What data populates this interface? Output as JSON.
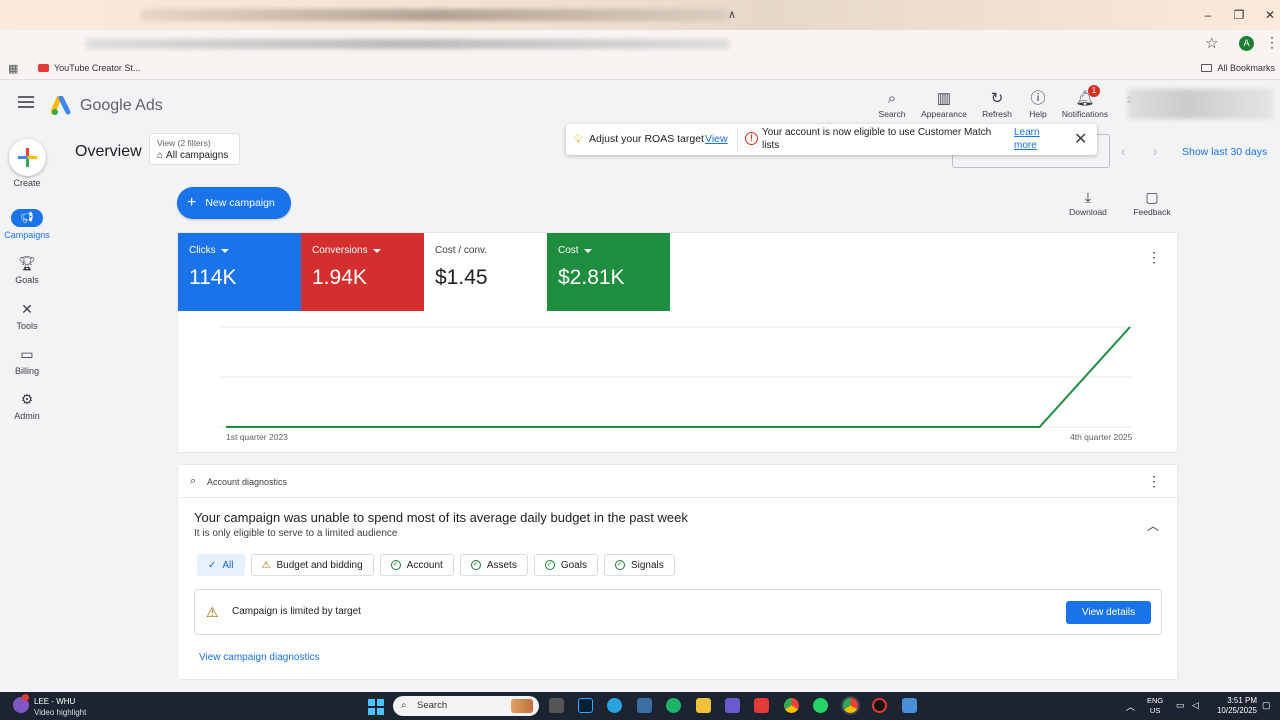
{
  "browser": {
    "bookmarks": [
      {
        "label": "YouTube Creator St..."
      }
    ],
    "all_bookmarks": "All Bookmarks",
    "profile_initial": "A",
    "win_controls": {
      "minimize": "–",
      "restore": "❐",
      "close": "✕"
    }
  },
  "header": {
    "brand": "Google Ads",
    "buttons": {
      "search": "Search",
      "appearance": "Appearance",
      "refresh": "Refresh",
      "help": "Help",
      "notifications": "Notifications"
    },
    "notification_count": "1",
    "account_prefix": "22"
  },
  "rail": {
    "create": "Create",
    "campaigns": "Campaigns",
    "goals": "Goals",
    "tools": "Tools",
    "billing": "Billing",
    "admin": "Admin"
  },
  "overview": {
    "title": "Overview",
    "filter_small": "View (2 filters)",
    "filter_big": "All campaigns",
    "show_last": "Show last 30 days"
  },
  "toast": {
    "message1": "Adjust your ROAS target",
    "view": "View",
    "message2": "Your account is now eligible to use Customer Match lists",
    "learn_more": "Learn more"
  },
  "actions": {
    "new_campaign": "New campaign",
    "download": "Download",
    "feedback": "Feedback"
  },
  "metrics": [
    {
      "label": "Clicks",
      "value": "114K",
      "color": "#1a73e8",
      "dropdown": true
    },
    {
      "label": "Conversions",
      "value": "1.94K",
      "color": "#d32f2f",
      "dropdown": true
    },
    {
      "label": "Cost / conv.",
      "value": "$1.45",
      "color": "#ffffff",
      "dropdown": false
    },
    {
      "label": "Cost",
      "value": "$2.81K",
      "color": "#1e8e3e",
      "dropdown": true
    }
  ],
  "chart_data": {
    "type": "line",
    "x": [
      "1st quarter 2023",
      "4th quarter 2025"
    ],
    "tick_labels": [
      "1st quarter 2023",
      "4th quarter 2025"
    ],
    "series": [
      {
        "color": "#1e8e3e",
        "values": [
          0,
          0,
          0,
          0,
          0,
          0,
          0,
          0,
          0,
          0,
          1
        ]
      }
    ],
    "grid": true
  },
  "diagnostics": {
    "header": "Account diagnostics",
    "title": "Your campaign was unable to spend most of its average daily budget in the past week",
    "subtitle": "It is only eligible to serve to a limited audience",
    "chips": [
      {
        "label": "All",
        "kind": "selected"
      },
      {
        "label": "Budget and bidding",
        "kind": "warning"
      },
      {
        "label": "Account",
        "kind": "ok"
      },
      {
        "label": "Assets",
        "kind": "ok"
      },
      {
        "label": "Goals",
        "kind": "ok"
      },
      {
        "label": "Signals",
        "kind": "ok"
      }
    ],
    "limited_text": "Campaign is limited by target",
    "view_details": "View details",
    "link": "View campaign diagnostics"
  },
  "taskbar": {
    "app_line1": "LEE - WHU",
    "app_line2": "Video highlight",
    "search": "Search",
    "lang1": "ENG",
    "lang2": "US",
    "time": "3:51 PM",
    "date": "10/25/2025"
  }
}
